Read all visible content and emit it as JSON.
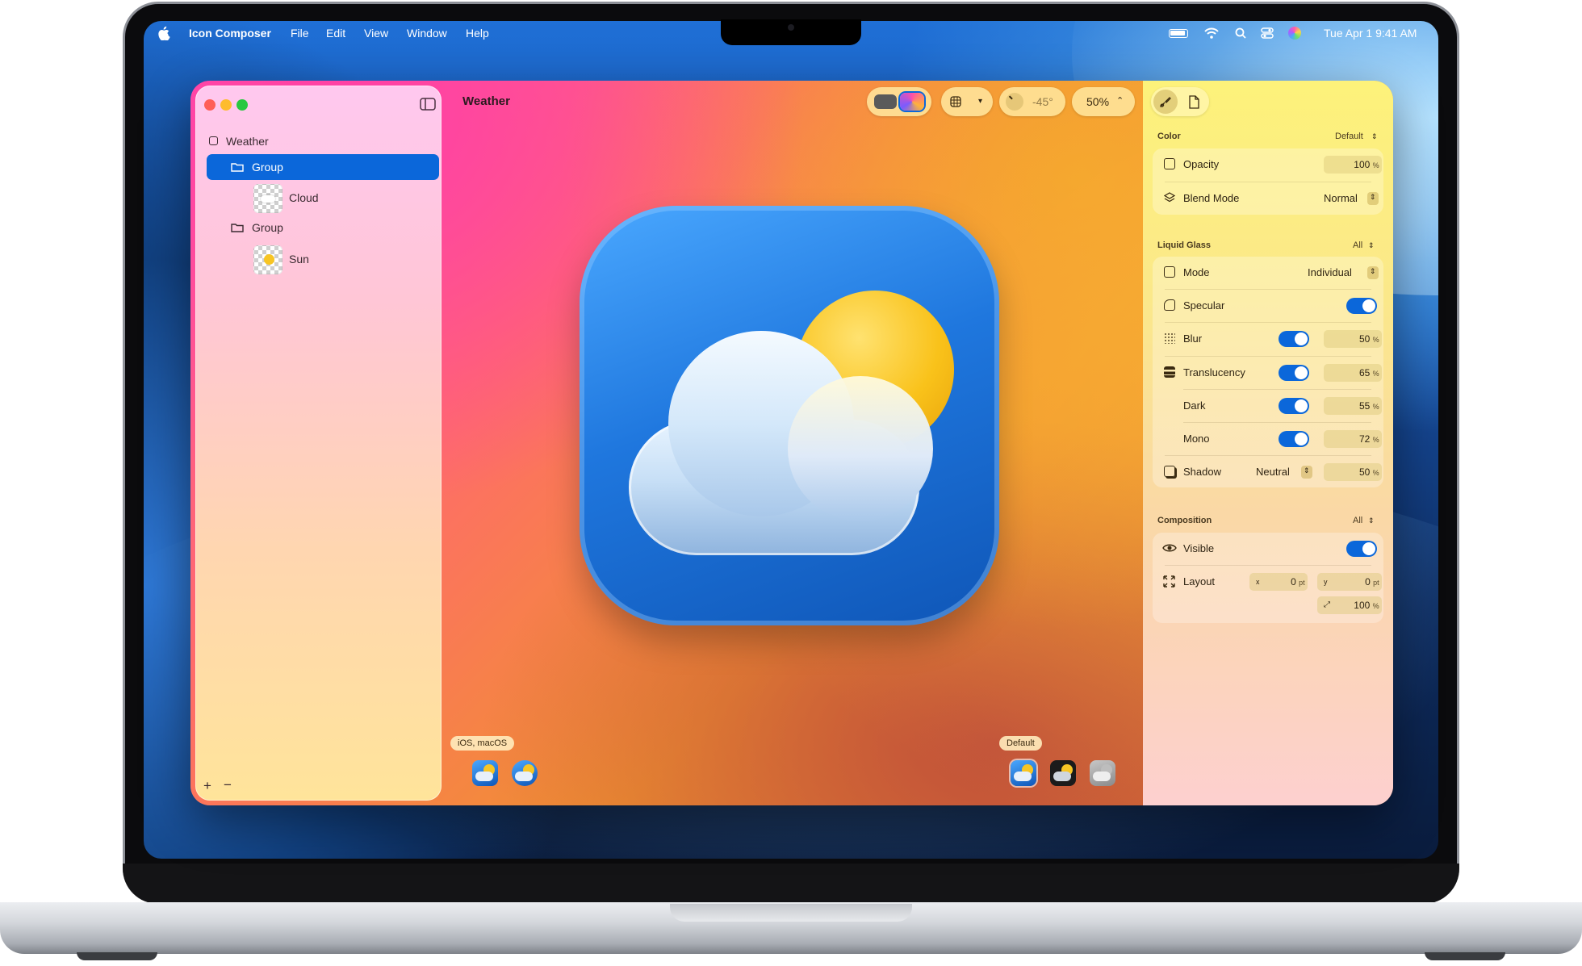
{
  "menubar": {
    "app_name": "Icon Composer",
    "menus": [
      "File",
      "Edit",
      "View",
      "Window",
      "Help"
    ],
    "clock": "Tue Apr 1  9:41 AM"
  },
  "window": {
    "title": "Weather"
  },
  "sidebar": {
    "layers": [
      {
        "label": "Weather",
        "type": "document"
      },
      {
        "label": "Group",
        "type": "group",
        "selected": true
      },
      {
        "label": "Cloud",
        "type": "layer"
      },
      {
        "label": "Group",
        "type": "group"
      },
      {
        "label": "Sun",
        "type": "layer"
      }
    ],
    "add_label": "+",
    "remove_label": "−"
  },
  "toolbar": {
    "light_angle": "-45°",
    "zoom": "50%"
  },
  "previews": {
    "platform_tag": "iOS, macOS",
    "appearance_tag": "Default"
  },
  "inspector": {
    "color": {
      "title": "Color",
      "menu": "Default",
      "opacity_label": "Opacity",
      "opacity_value": "100",
      "blend_label": "Blend Mode",
      "blend_value": "Normal"
    },
    "liquid_glass": {
      "title": "Liquid Glass",
      "menu": "All",
      "mode_label": "Mode",
      "mode_value": "Individual",
      "specular_label": "Specular",
      "specular_on": true,
      "blur_label": "Blur",
      "blur_value": "50",
      "translucency_label": "Translucency",
      "translucency_value": "65",
      "dark_label": "Dark",
      "dark_value": "55",
      "mono_label": "Mono",
      "mono_value": "72",
      "shadow_label": "Shadow",
      "shadow_mode": "Neutral",
      "shadow_value": "50"
    },
    "composition": {
      "title": "Composition",
      "menu": "All",
      "visible_label": "Visible",
      "visible_on": true,
      "layout_label": "Layout",
      "x_label": "x",
      "x_value": "0",
      "y_label": "y",
      "y_value": "0",
      "scale_value": "100"
    },
    "units": {
      "percent": "%",
      "point": "pt"
    }
  },
  "colors": {
    "accent": "#0b67da"
  }
}
